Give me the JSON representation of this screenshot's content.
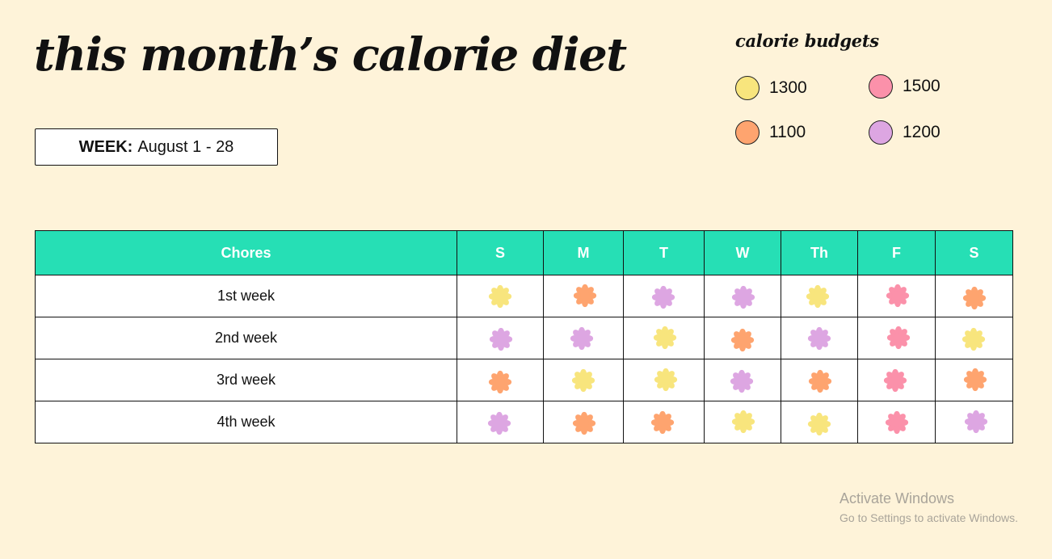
{
  "title": "this month’s calorie diet",
  "week": {
    "label": "WEEK:",
    "range": "August  1 - 28"
  },
  "legend": {
    "title": "calorie budgets",
    "items": [
      {
        "value": "1300",
        "color": "#f8e57d"
      },
      {
        "value": "1500",
        "color": "#fb91aa"
      },
      {
        "value": "1100",
        "color": "#fea46f"
      },
      {
        "value": "1200",
        "color": "#dda6e2"
      }
    ]
  },
  "table": {
    "headers": [
      "Chores",
      "S",
      "M",
      "T",
      "W",
      "Th",
      "F",
      "S"
    ],
    "rows": [
      {
        "label": "1st week",
        "days": [
          "1300",
          "1100",
          "1200",
          "1200",
          "1300",
          "1500",
          "1100"
        ]
      },
      {
        "label": "2nd week",
        "days": [
          "1200",
          "1200",
          "1300",
          "1100",
          "1200",
          "1500",
          "1300"
        ]
      },
      {
        "label": "3rd week",
        "days": [
          "1100",
          "1300",
          "1300",
          "1200",
          "1100",
          "1500",
          "1100"
        ]
      },
      {
        "label": "4th week",
        "days": [
          "1200",
          "1100",
          "1100",
          "1300",
          "1300",
          "1500",
          "1200"
        ]
      }
    ]
  },
  "watermark": {
    "line1": "Activate Windows",
    "line2": "Go to Settings to activate Windows."
  }
}
